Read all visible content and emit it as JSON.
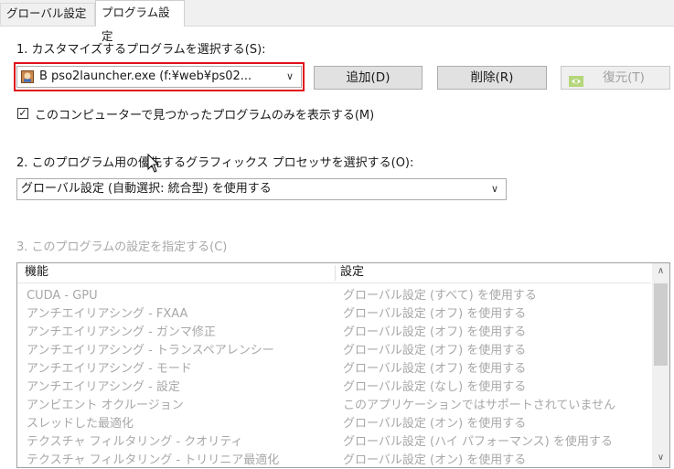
{
  "tabs": [
    "グローバル設定",
    "プログラム設定"
  ],
  "step1": {
    "label": "1. カスタマイズするプログラムを選択する(S):",
    "program_combo": {
      "value": "B pso2launcher.exe (f:¥web¥ps02...",
      "icon": "program-app-icon"
    },
    "add_button": "追加(D)",
    "remove_button": "削除(R)",
    "restore_button": "復元(T)",
    "restore_icon": "nvidia-icon",
    "checkbox_label": "このコンピューターで見つかったプログラムのみを表示する(M)",
    "checkbox_checked": true
  },
  "step2": {
    "label": "2. このプログラム用の優先するグラフィックス プロセッサを選択する(O):",
    "gpu_combo_value": "グローバル設定 (自動選択: 統合型) を使用する"
  },
  "step3": {
    "label": "3. このプログラムの設定を指定する(C)",
    "columns": [
      "機能",
      "設定"
    ],
    "rows": [
      {
        "feature": "CUDA - GPU",
        "setting": "グローバル設定 (すべて) を使用する"
      },
      {
        "feature": "アンチエイリアシング - FXAA",
        "setting": "グローバル設定 (オフ) を使用する"
      },
      {
        "feature": "アンチエイリアシング - ガンマ修正",
        "setting": "グローバル設定 (オフ) を使用する"
      },
      {
        "feature": "アンチエイリアシング - トランスペアレンシー",
        "setting": "グローバル設定 (オフ) を使用する"
      },
      {
        "feature": "アンチエイリアシング - モード",
        "setting": "グローバル設定 (オフ) を使用する"
      },
      {
        "feature": "アンチエイリアシング - 設定",
        "setting": "グローバル設定 (なし) を使用する"
      },
      {
        "feature": "アンビエント オクルージョン",
        "setting": "このアプリケーションではサポートされていません"
      },
      {
        "feature": "スレッドした最適化",
        "setting": "グローバル設定 (オン) を使用する"
      },
      {
        "feature": "テクスチャ フィルタリング - クオリティ",
        "setting": "グローバル設定 (ハイ パフォーマンス) を使用する"
      },
      {
        "feature": "テクスチャ フィルタリング - トリリニア最適化",
        "setting": "グローバル設定 (オン) を使用する"
      }
    ]
  },
  "colors": {
    "highlight_border": "#e0101a",
    "disabled_text": "#a8a8a8",
    "nvidia_green": "#76b900"
  }
}
